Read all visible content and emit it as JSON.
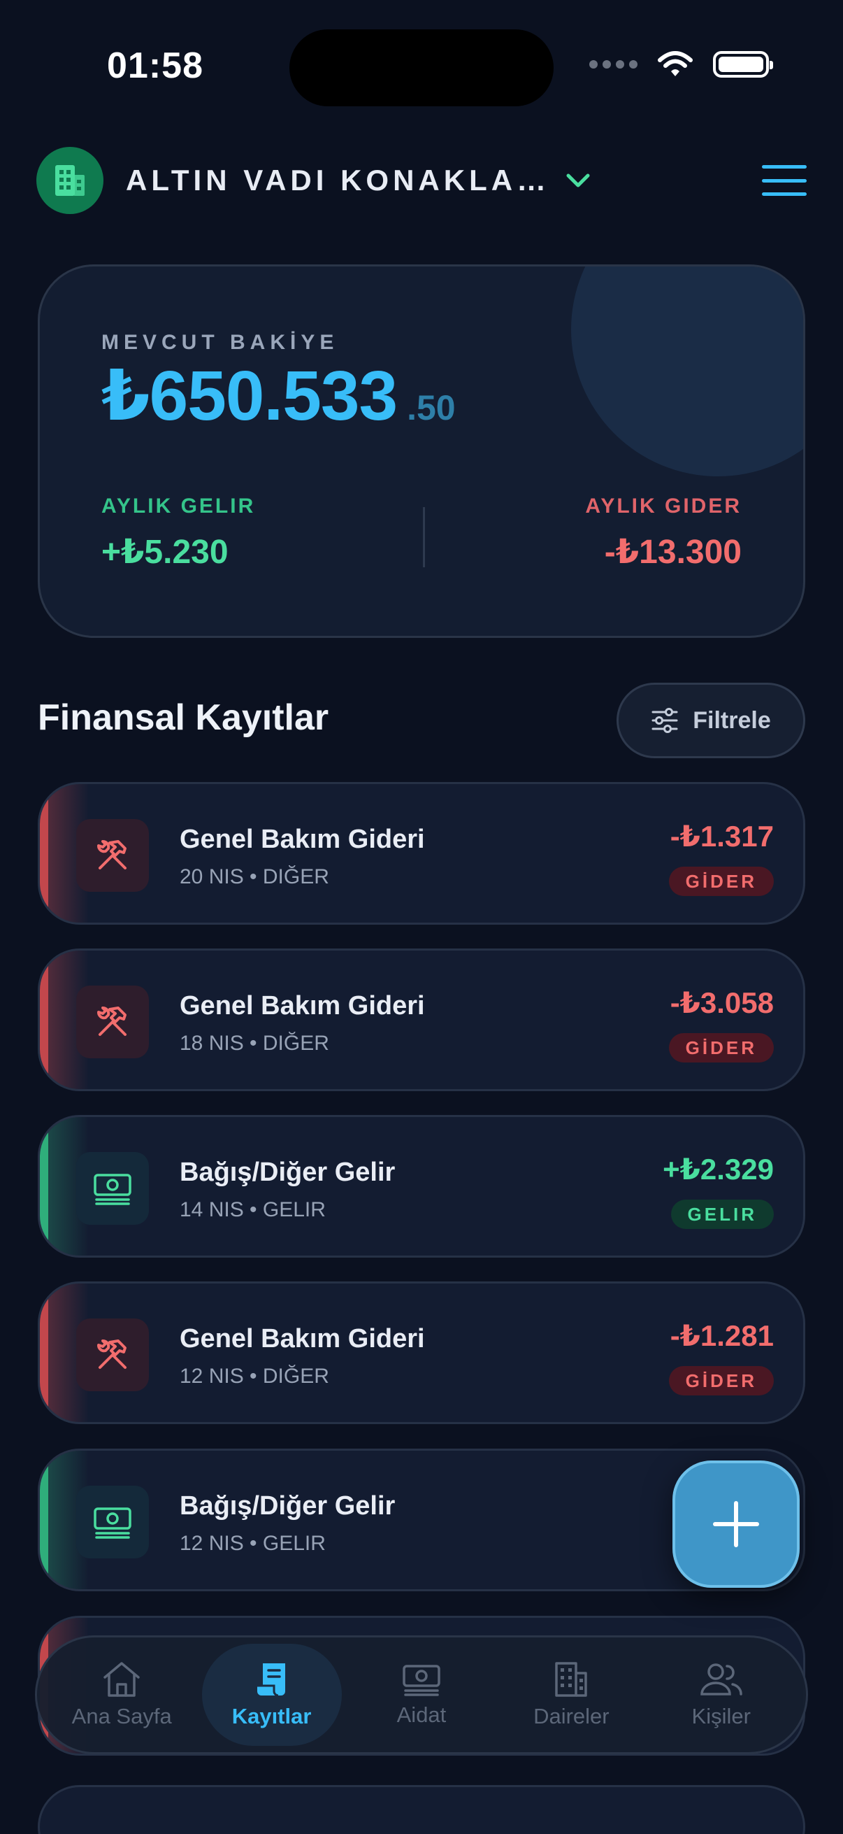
{
  "status_bar": {
    "time": "01:58"
  },
  "header": {
    "title": "ALTIN VADI KONAKLA…"
  },
  "balance": {
    "label": "MEVCUT BAKİYE",
    "amount": "₺650.533",
    "cents": ".50",
    "income_label": "AYLIK GELIR",
    "income_value": "+₺5.230",
    "expense_label": "AYLIK GIDER",
    "expense_value": "-₺13.300"
  },
  "section": {
    "title": "Finansal Kayıtlar",
    "filter_label": "Filtrele"
  },
  "records": [
    {
      "title": "Genel Bakım Gideri",
      "subtitle": "20 NIS • DIĞER",
      "amount": "-₺1.317",
      "badge": "GİDER",
      "type": "expense",
      "icon": "hammer-wrench-icon"
    },
    {
      "title": "Genel Bakım Gideri",
      "subtitle": "18 NIS • DIĞER",
      "amount": "-₺3.058",
      "badge": "GİDER",
      "type": "expense",
      "icon": "hammer-wrench-icon"
    },
    {
      "title": "Bağış/Diğer Gelir",
      "subtitle": "14 NIS • GELIR",
      "amount": "+₺2.329",
      "badge": "GELIR",
      "type": "income",
      "icon": "banknote-icon"
    },
    {
      "title": "Genel Bakım Gideri",
      "subtitle": "12 NIS • DIĞER",
      "amount": "-₺1.281",
      "badge": "GİDER",
      "type": "expense",
      "icon": "hammer-wrench-icon"
    },
    {
      "title": "Bağış/Diğer Gelir",
      "subtitle": "12 NIS • GELIR",
      "type": "income",
      "icon": "banknote-icon"
    }
  ],
  "nav": {
    "items": [
      {
        "label": "Ana Sayfa",
        "icon": "home-icon"
      },
      {
        "label": "Kayıtlar",
        "icon": "receipt-icon",
        "active": true
      },
      {
        "label": "Aidat",
        "icon": "banknote-icon"
      },
      {
        "label": "Daireler",
        "icon": "building-icon"
      },
      {
        "label": "Kişiler",
        "icon": "users-icon"
      }
    ]
  },
  "colors": {
    "accent": "#38bdf8",
    "income": "#4ade9f",
    "expense": "#f26d6d",
    "background": "#0b1120"
  }
}
